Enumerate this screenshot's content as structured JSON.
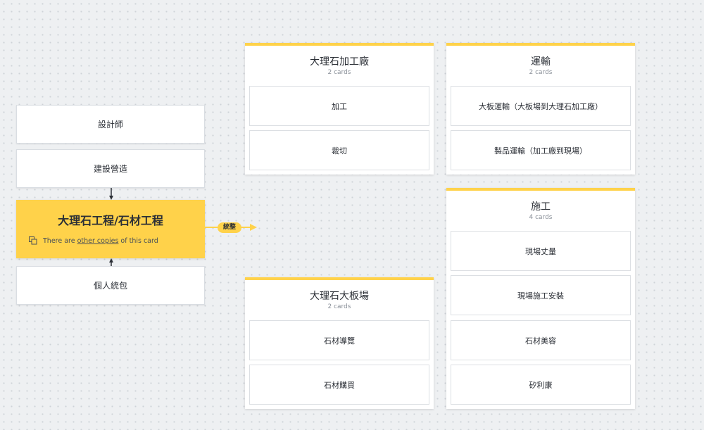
{
  "left_cards": [
    {
      "label": "設計師"
    },
    {
      "label": "建設營造"
    },
    {
      "label": "個人統包"
    }
  ],
  "focus_card": {
    "title": "大理石工程/石材工程",
    "copies_prefix": "There are",
    "copies_link": "other copies",
    "copies_suffix": "of this card"
  },
  "connector": {
    "label": "統整"
  },
  "groups": [
    {
      "title": "大理石加工廠",
      "count": "2 cards",
      "items": [
        "加工",
        "裁切"
      ]
    },
    {
      "title": "運輸",
      "count": "2 cards",
      "items": [
        "大板運輸（大板場到大理石加工廠）",
        "製品運輸（加工廠到現場）"
      ]
    },
    {
      "title": "施工",
      "count": "4 cards",
      "items": [
        "現場丈量",
        "現場施工安裝",
        "石材美容",
        "矽利康"
      ]
    },
    {
      "title": "大理石大板場",
      "count": "2 cards",
      "items": [
        "石材導覽",
        "石材購買"
      ]
    }
  ],
  "colors": {
    "accent": "#ffd24a",
    "canvas": "#eef0f2",
    "card": "#ffffff"
  }
}
